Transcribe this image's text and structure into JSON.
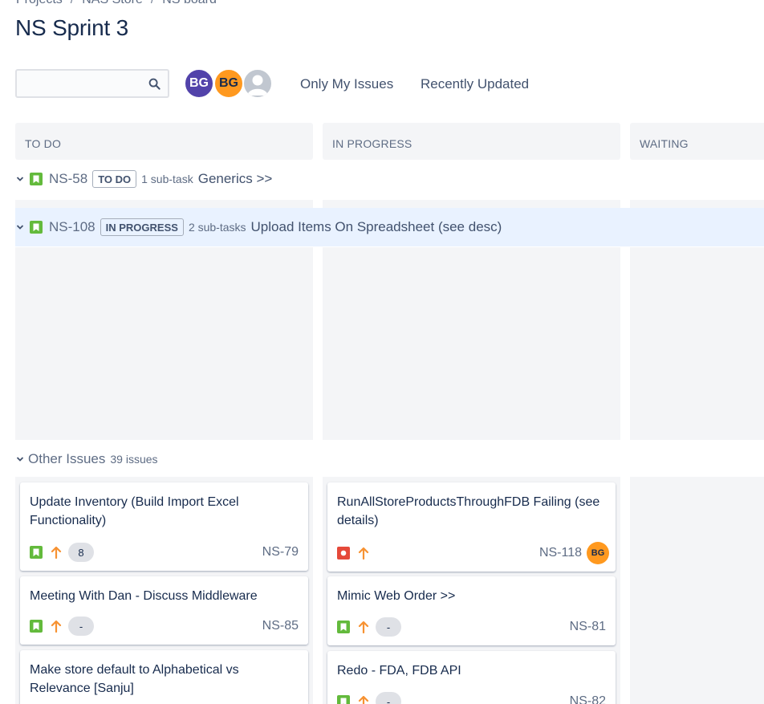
{
  "breadcrumb": {
    "items": [
      "Projects",
      "NAS Store",
      "NS board"
    ],
    "separator": "/"
  },
  "page_title": "NS Sprint 3",
  "search": {
    "value": "",
    "placeholder": ""
  },
  "avatars": [
    {
      "initials": "BG",
      "color": "#5243aa"
    },
    {
      "initials": "BG",
      "color": "#ff991f"
    },
    {
      "initials": "",
      "color": "#c1c7d0"
    }
  ],
  "quick_filters": [
    "Only My Issues",
    "Recently Updated"
  ],
  "columns": [
    "TO DO",
    "IN PROGRESS",
    "WAITING"
  ],
  "swimlanes": [
    {
      "key": "NS-58",
      "status": "TO DO",
      "subtasks": "1 sub-task",
      "summary": "Generics >>"
    },
    {
      "key": "NS-108",
      "status": "IN PROGRESS",
      "subtasks": "2 sub-tasks",
      "summary": "Upload Items On Spreadsheet (see desc)"
    }
  ],
  "other_issues": {
    "label": "Other Issues",
    "count": "39 issues"
  },
  "cards": {
    "todo": [
      {
        "title": "Update Inventory (Build Import Excel Functionality)",
        "type": "story",
        "estimate": "8",
        "key": "NS-79"
      },
      {
        "title": "Meeting With Dan - Discuss Middleware",
        "type": "story",
        "estimate": "-",
        "key": "NS-85"
      },
      {
        "title": "Make store default to Alphabetical vs Relevance [Sanju]",
        "type": "story",
        "estimate": "",
        "key": ""
      }
    ],
    "in_progress": [
      {
        "title": "RunAllStoreProductsThroughFDB Failing (see details)",
        "type": "bug",
        "estimate": "",
        "key": "NS-118",
        "assignee": "BG"
      },
      {
        "title": "Mimic Web Order >>",
        "type": "story",
        "estimate": "-",
        "key": "NS-81"
      },
      {
        "title": "Redo - FDA, FDB API",
        "type": "story",
        "estimate": "-",
        "key": "NS-82"
      }
    ]
  },
  "colors": {
    "story": "#63ba3c",
    "bug": "#e5493a",
    "priority_high": "#f79232",
    "column_bg": "#f4f5f7",
    "highlight": "#e9f2ff"
  }
}
